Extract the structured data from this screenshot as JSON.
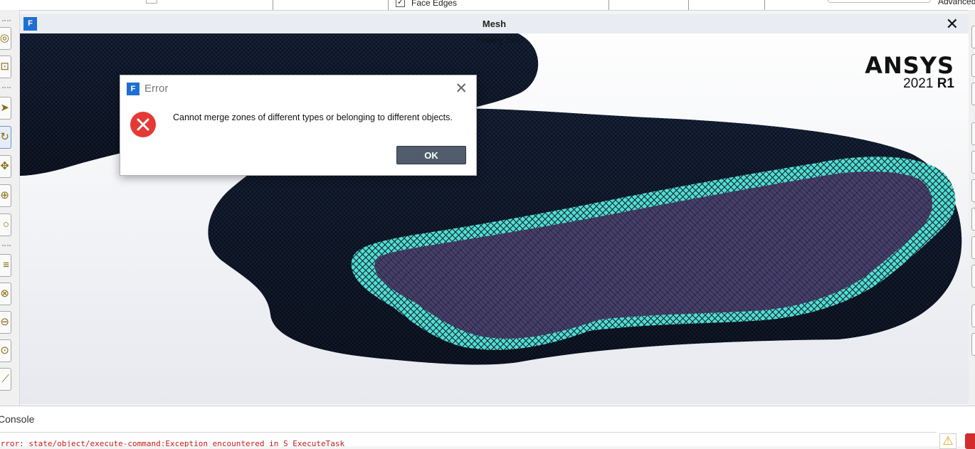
{
  "toolbar": {
    "face_edges_label": "Face Edges",
    "face_edges_checked": true,
    "advanced_label": "Advanced"
  },
  "graphics": {
    "title": "Mesh",
    "hotkey_help": "Hotkey Help",
    "logo_name": "ANSYS",
    "logo_year": "2021",
    "logo_release": "R1"
  },
  "dialog": {
    "title": "Error",
    "message": "Cannot merge zones of different types or belonging to different objects.",
    "ok_label": "OK"
  },
  "console": {
    "title": "Console",
    "line": "Error: state/object/execute-command:Exception encountered in S ExecuteTask"
  },
  "colors": {
    "ok_button": "#515c6c",
    "error_icon": "#e53935",
    "boundary_mesh": "#4dd6d0",
    "mesh_fill": "#453f66",
    "console_error_text": "#c41a1a",
    "app_icon": "#1f6fd0"
  },
  "icons": {
    "app": "fluent-app-icon",
    "error": "error-circle-icon",
    "warning": "warning-icon"
  }
}
